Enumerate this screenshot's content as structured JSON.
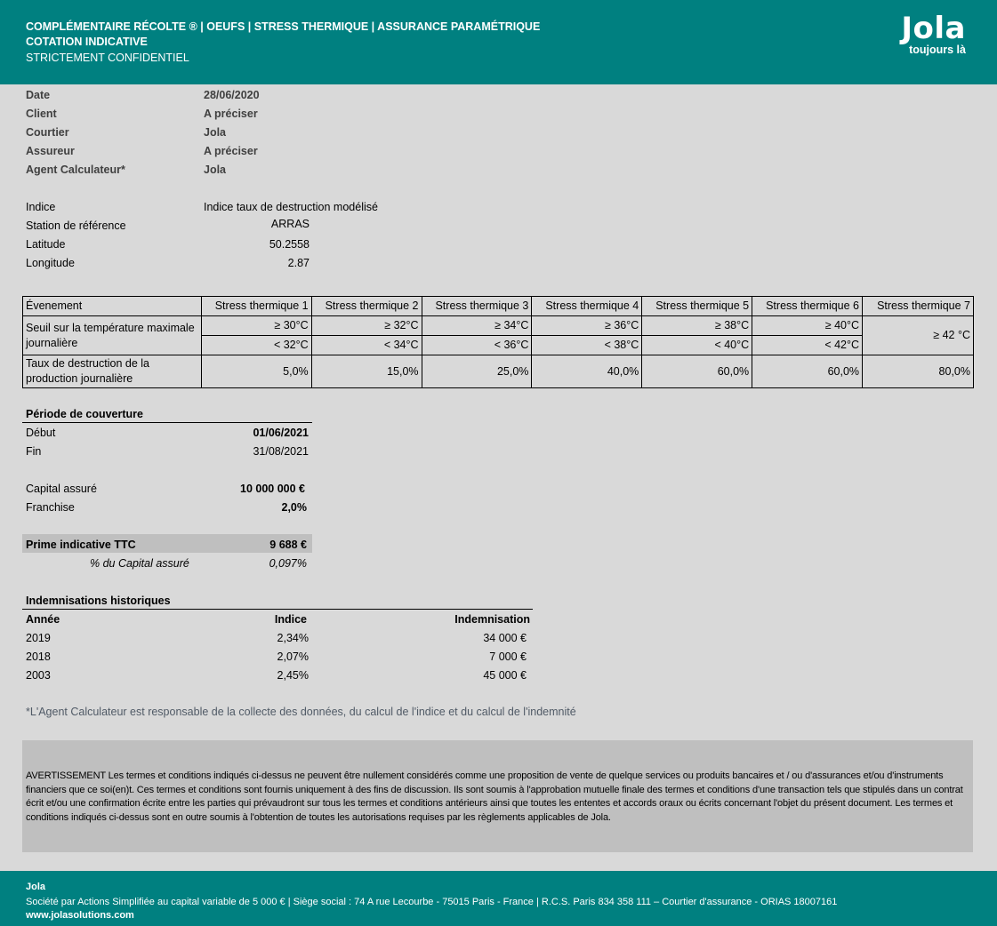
{
  "header": {
    "line1": "COMPLÉMENTAIRE RÉCOLTE ® | OEUFS | STRESS THERMIQUE | ASSURANCE PARAMÉTRIQUE",
    "line2": "COTATION INDICATIVE",
    "line3": "STRICTEMENT CONFIDENTIEL",
    "logo": "Jola",
    "tagline": "toujours là"
  },
  "info": [
    {
      "label": "Date",
      "value": "28/06/2020"
    },
    {
      "label": "Client",
      "value": "A préciser"
    },
    {
      "label": "Courtier",
      "value": "Jola"
    },
    {
      "label": "Assureur",
      "value": "A préciser"
    },
    {
      "label": "Agent Calculateur*",
      "value": "Jola"
    }
  ],
  "index": {
    "indice_label": "Indice",
    "indice_value": "Indice taux de destruction modélisé",
    "station_label": "Station de référence",
    "station_value": "ARRAS",
    "lat_label": "Latitude",
    "lat_value": "50.2558",
    "lon_label": "Longitude",
    "lon_value": "2.87"
  },
  "events": {
    "header_label": "Évenement",
    "columns": [
      "Stress thermique 1",
      "Stress thermique 2",
      "Stress thermique 3",
      "Stress thermique 4",
      "Stress thermique 5",
      "Stress thermique 6",
      "Stress thermique 7"
    ],
    "seuil_label": "Seuil sur la température maximale journalière",
    "seuil_min": [
      "≥  30°C",
      "≥  32°C",
      "≥  34°C",
      "≥  36°C",
      "≥  38°C",
      "≥  40°C",
      "≥  42 °C"
    ],
    "seuil_max": [
      "< 32°C",
      "< 34°C",
      "< 36°C",
      "< 38°C",
      "< 40°C",
      "< 42°C"
    ],
    "taux_label": "Taux de destruction de la production journalière",
    "taux": [
      "5,0%",
      "15,0%",
      "25,0%",
      "40,0%",
      "60,0%",
      "60,0%",
      "80,0%"
    ]
  },
  "coverage": {
    "title": "Période de couverture",
    "debut_label": "Début",
    "debut_value": "01/06/2021",
    "fin_label": "Fin",
    "fin_value": "31/08/2021",
    "capital_label": "Capital assuré",
    "capital_value": "10 000 000 €",
    "franchise_label": "Franchise",
    "franchise_value": "2,0%",
    "prime_label": "Prime indicative TTC",
    "prime_value": "9 688 €",
    "pct_label": "% du Capital assuré",
    "pct_value": "0,097%"
  },
  "history": {
    "title": "Indemnisations historiques",
    "headers": [
      "Année",
      "Indice",
      "Indemnisation"
    ],
    "rows": [
      [
        "2019",
        "2,34%",
        "34 000 €"
      ],
      [
        "2018",
        "2,07%",
        "7 000 €"
      ],
      [
        "2003",
        "2,45%",
        "45 000 €"
      ]
    ]
  },
  "note": "*L'Agent Calculateur est responsable de la collecte des données, du calcul de l'indice et du calcul de l'indemnité",
  "disclaimer": "AVERTISSEMENT Les termes et conditions indiqués ci-dessus ne peuvent être nullement considérés comme une proposition de vente de quelque services ou produits bancaires et / ou d'assurances et/ou d'instruments financiers que ce soi(en)t. Ces termes et conditions sont fournis uniquement à des fins de discussion. Ils sont soumis à l'approbation mutuelle finale des termes et conditions d'une transaction tels que stipulés dans un contrat écrit et/ou une confirmation écrite entre les parties qui prévaudront sur tous les termes et conditions antérieurs ainsi que toutes les ententes et accords oraux ou écrits concernant l'objet du présent document. Les termes et conditions indiqués ci-dessus sont en outre soumis à l'obtention de toutes les autorisations requises par les règlements applicables de Jola.",
  "footer": {
    "company": "Jola",
    "address": "Société par Actions Simplifiée au capital variable de 5 000 € | Siège social : 74 A rue Lecourbe - 75015 Paris - France | R.C.S. Paris 834 358 111 – Courtier d'assurance - ORIAS 18007161",
    "website": "www.jolasolutions.com"
  },
  "colors": {
    "brand": "#008080",
    "background": "#d9d9d9",
    "panel": "#bfbfbf"
  }
}
